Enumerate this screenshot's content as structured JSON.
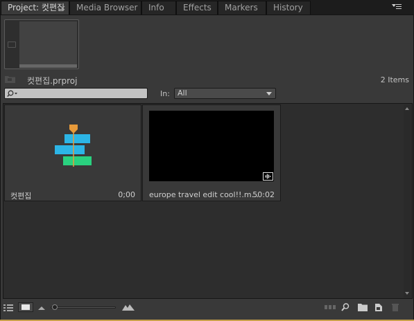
{
  "tabs": [
    {
      "label": "Project: 컷편집",
      "active": true,
      "close": "×"
    },
    {
      "label": "Media Browser",
      "active": false
    },
    {
      "label": "Info",
      "active": false
    },
    {
      "label": "Effects",
      "active": false
    },
    {
      "label": "Markers",
      "active": false
    },
    {
      "label": "History",
      "active": false
    }
  ],
  "project": {
    "file_name": "컷편집.prproj",
    "item_count": "2 Items"
  },
  "search": {
    "value": "",
    "placeholder": ""
  },
  "filter": {
    "label": "In:",
    "selected": "All"
  },
  "items": [
    {
      "name": "컷편집",
      "duration": "0;00",
      "kind": "sequence-icon"
    },
    {
      "name": "europe travel edit cool!!.m...",
      "duration": "50:02",
      "kind": "video-clip-icon"
    }
  ],
  "colors": {
    "accent": "#c8a04a",
    "sequence_blue": "#2cb5e6",
    "sequence_green": "#2ad17f",
    "playhead": "#e79a3a"
  },
  "toolbar_icons": [
    "list-view-icon",
    "icon-view-icon",
    "zoom-out-icon",
    "zoom-slider",
    "zoom-in-icon",
    "automate-to-sequence-icon",
    "find-icon",
    "new-bin-icon",
    "new-item-icon",
    "clear-icon"
  ]
}
